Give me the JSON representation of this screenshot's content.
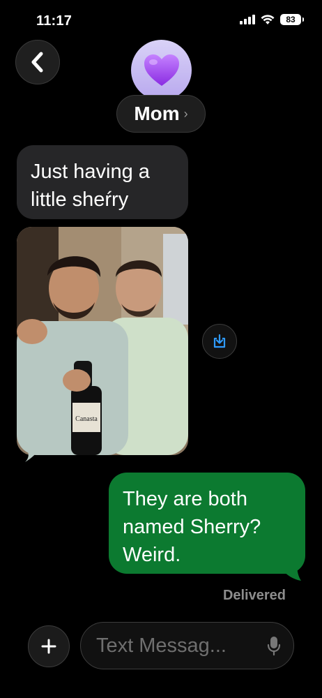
{
  "status_bar": {
    "time": "11:17",
    "battery": "83",
    "icons": [
      "signal-icon",
      "wifi-icon",
      "battery-icon"
    ]
  },
  "header": {
    "back_icon": "chevron-left-icon",
    "avatar_emoji": "💜",
    "contact_name": "Mom",
    "contact_chevron": "›"
  },
  "messages": [
    {
      "direction": "incoming",
      "lines": [
        "Just having a",
        "little sheŕry"
      ]
    },
    {
      "direction": "incoming",
      "type": "photo",
      "bottle_label": "Canasta",
      "save_icon": "save-download-icon"
    },
    {
      "direction": "outgoing",
      "lines": [
        "They are both",
        "named Sherry?",
        "Weird."
      ],
      "status": "Delivered"
    }
  ],
  "composer": {
    "plus_icon": "plus-icon",
    "placeholder": "Text Messag...",
    "mic_icon": "microphone-icon"
  },
  "colors": {
    "background": "#000000",
    "incoming_bubble": "#262628",
    "outgoing_bubble": "#0c7a30",
    "accent_blue": "#2f9bff",
    "avatar_bg": "#c7b9f2"
  }
}
